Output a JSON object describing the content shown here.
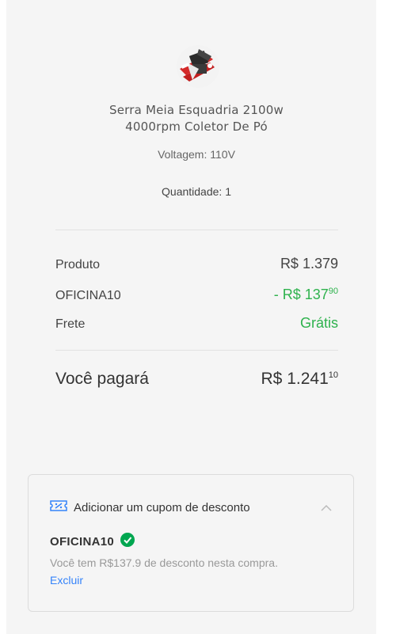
{
  "product": {
    "title_line1": "Serra Meia Esquadria 2100w",
    "title_line2": "4000rpm Coletor De Pó",
    "variant": "Voltagem: 110V",
    "quantity": "Quantidade: 1"
  },
  "summary": {
    "product_label": "Produto",
    "product_value": "R$ 1.379",
    "coupon_label": "OFICINA10",
    "coupon_value_main": "- R$ 137",
    "coupon_value_cents": "90",
    "shipping_label": "Frete",
    "shipping_value": "Grátis",
    "total_label": "Você pagará",
    "total_value_main": "R$ 1.241",
    "total_value_cents": "10"
  },
  "coupon": {
    "header": "Adicionar um cupom de desconto",
    "code": "OFICINA10",
    "message": "Você tem R$137.9 de desconto nesta compra.",
    "remove_label": "Excluir"
  },
  "colors": {
    "accent_green": "#2eb24d",
    "link_blue": "#3483fa"
  },
  "icons": [
    "product-thumbnail",
    "coupon-ticket-icon",
    "chevron-up-icon",
    "check-circle-icon"
  ]
}
